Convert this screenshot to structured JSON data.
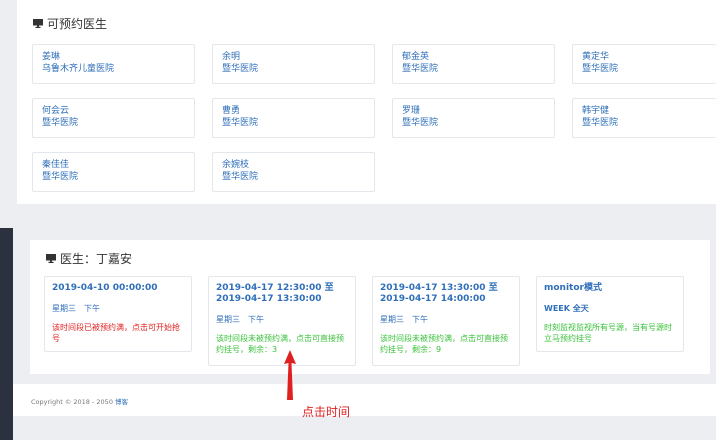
{
  "available_doctors": {
    "title": "可预约医生",
    "doctors": [
      {
        "name": "姜琳",
        "hospital": "乌鲁木齐儿童医院"
      },
      {
        "name": "余明",
        "hospital": "暨华医院"
      },
      {
        "name": "郁金英",
        "hospital": "暨华医院"
      },
      {
        "name": "黄定华",
        "hospital": "暨华医院"
      },
      {
        "name": "何会云",
        "hospital": "暨华医院"
      },
      {
        "name": "曹勇",
        "hospital": "暨华医院"
      },
      {
        "name": "罗珊",
        "hospital": "暨华医院"
      },
      {
        "name": "韩宇健",
        "hospital": "暨华医院"
      },
      {
        "name": "秦佳佳",
        "hospital": "暨华医院"
      },
      {
        "name": "余婉枝",
        "hospital": "暨华医院"
      }
    ]
  },
  "doctor_detail": {
    "title": "医生：丁嘉安",
    "slots": [
      {
        "time_line1": "2019-04-10 00:00:00",
        "time_line2": "",
        "week": "星期三　下午",
        "note": "该时间段已被预约满，点击可开始抢号",
        "note_color": "red"
      },
      {
        "time_line1": "2019-04-17 12:30:00 至",
        "time_line2": "2019-04-17 13:30:00",
        "week": "星期三　下午",
        "note": "该时间段未被预约满，点击可直接预约挂号，剩余：3",
        "note_color": "green"
      },
      {
        "time_line1": "2019-04-17 13:30:00 至",
        "time_line2": "2019-04-17 14:00:00",
        "week": "星期三　下午",
        "note": "该时间段未被预约满，点击可直接预约挂号，剩余：9",
        "note_color": "green"
      },
      {
        "time_line1": "monitor模式",
        "time_line2": "",
        "week": "WEEK 全天",
        "note": "时刻监视监视所有号源，当有号源时立马预约挂号",
        "note_color": "green"
      }
    ]
  },
  "footer": {
    "copyright": "Copyright © 2018 - 2050 ",
    "link": "博客"
  },
  "annotation": {
    "label": "点击时间"
  },
  "colors": {
    "link_blue": "#2f6fb9",
    "alert_red": "#e02020",
    "ok_green": "#39c23a"
  }
}
